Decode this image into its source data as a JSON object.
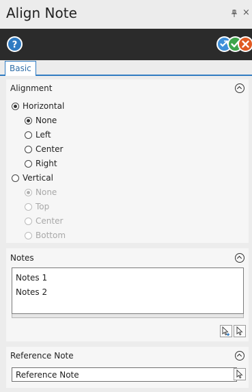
{
  "window": {
    "title": "Align Note",
    "pin_icon": "pin-icon",
    "close_glyph": "×"
  },
  "toolbar": {
    "help_icon": "help-icon",
    "apply_icon": "apply-and-continue-icon",
    "ok_icon": "ok-check-icon",
    "cancel_icon": "cancel-x-icon"
  },
  "tabs": [
    {
      "label": "Basic",
      "active": true
    }
  ],
  "alignment": {
    "title": "Alignment",
    "horizontal": {
      "label": "Horizontal",
      "selected": true,
      "options": [
        {
          "label": "None",
          "selected": true
        },
        {
          "label": "Left",
          "selected": false
        },
        {
          "label": "Center",
          "selected": false
        },
        {
          "label": "Right",
          "selected": false
        }
      ]
    },
    "vertical": {
      "label": "Vertical",
      "selected": false,
      "options": [
        {
          "label": "None",
          "selected": true,
          "disabled": true
        },
        {
          "label": "Top",
          "selected": false,
          "disabled": true
        },
        {
          "label": "Center",
          "selected": false,
          "disabled": true
        },
        {
          "label": "Bottom",
          "selected": false,
          "disabled": true
        }
      ]
    }
  },
  "notes": {
    "title": "Notes",
    "items": [
      "Notes 1",
      "Notes 2"
    ]
  },
  "reference_note": {
    "title": "Reference Note",
    "value": "Reference Note"
  },
  "colors": {
    "toolbar_bg": "#2b2b2b",
    "accent_blue": "#2f7bc2",
    "ok_green": "#3ea44a",
    "cancel_orange": "#e05a22"
  }
}
